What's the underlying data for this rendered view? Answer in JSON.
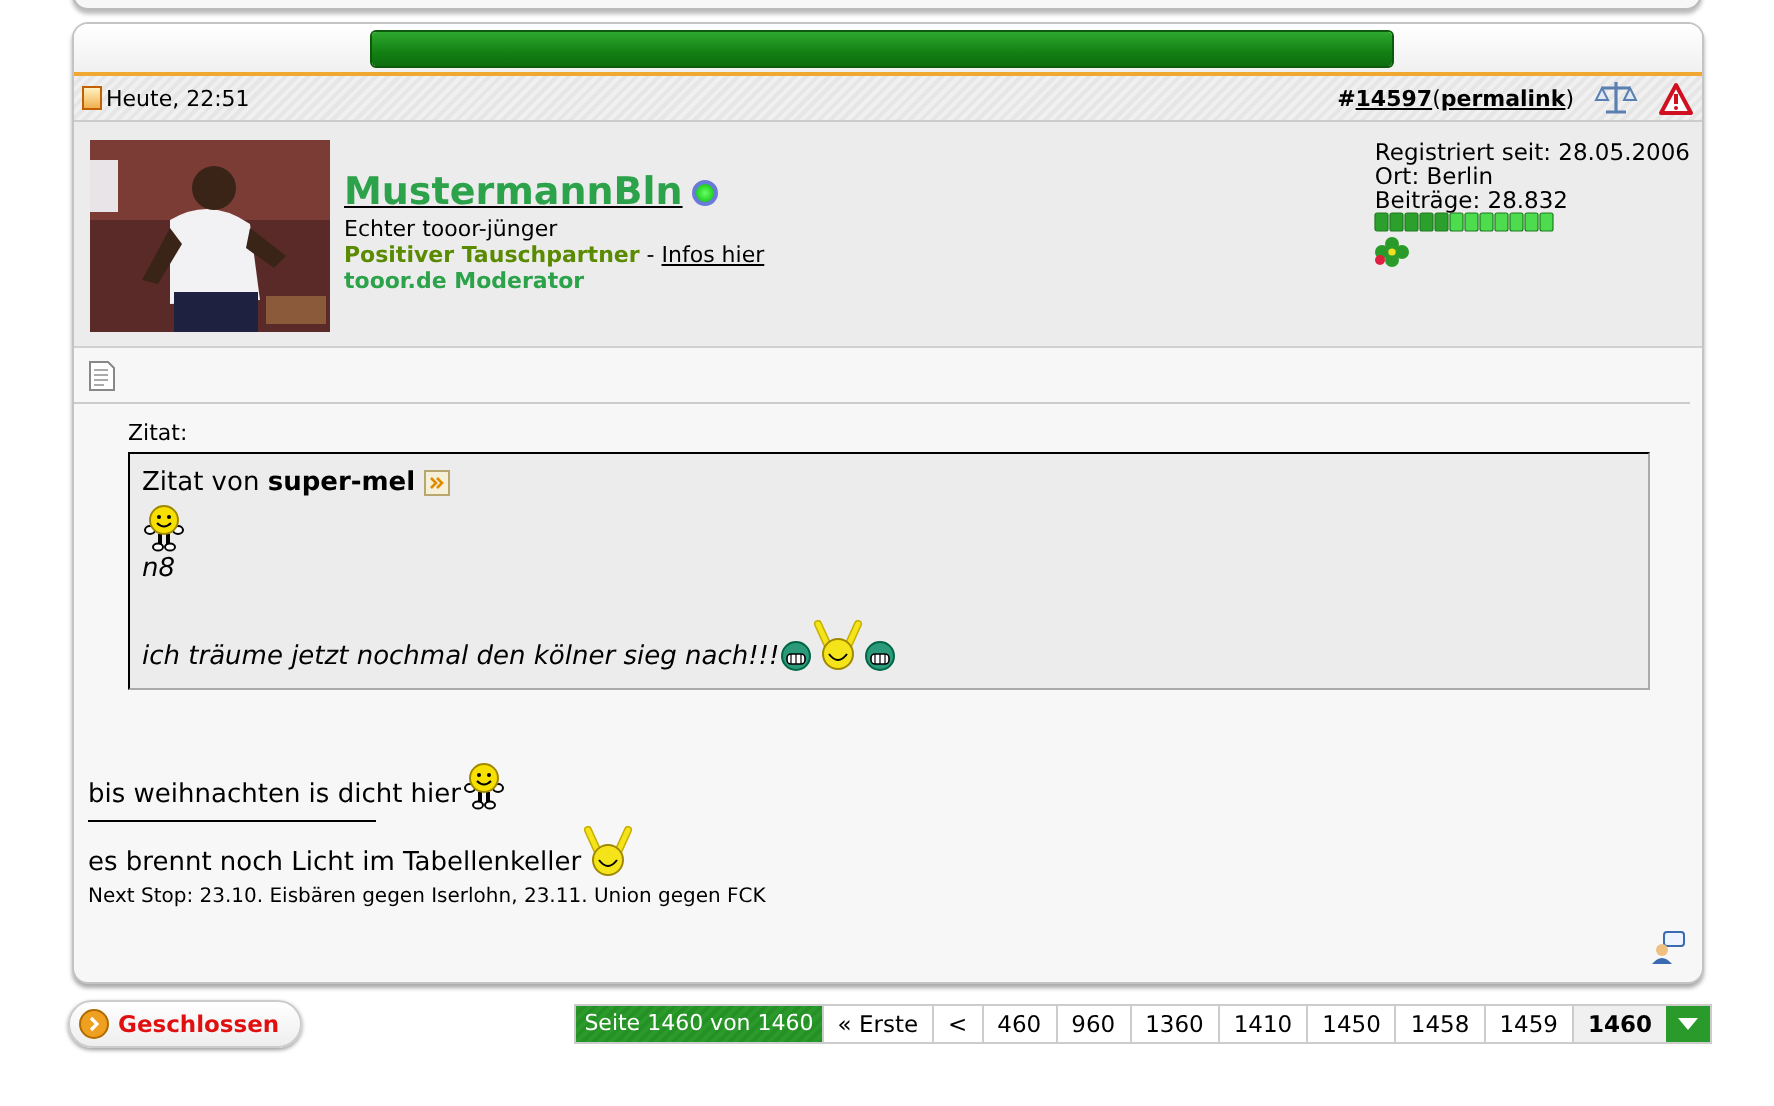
{
  "post": {
    "progress": {
      "level": 1
    },
    "date": "Heute, 22:51",
    "number_prefix": "#",
    "number": "14597",
    "permalink_open": "(",
    "permalink": "permalink",
    "permalink_close": ")",
    "user": {
      "name": "MustermannBln",
      "online": true,
      "title": "Echter tooor-jünger",
      "trade_label": "Positiver Tauschpartner",
      "separator": "-",
      "trade_link": "Infos hier",
      "role": "tooor.de Moderator"
    },
    "user_info": [
      "Registriert seit: 28.05.2006",
      "Ort: Berlin",
      "Beiträge: 28.832"
    ],
    "quote": {
      "label": "Zitat:",
      "heading": "Zitat von **super-mel**",
      "lines": [
        {
          "emoticons": [
            {
              "kind": "walking"
            }
          ]
        },
        {
          "text": "n8"
        },
        {
          "text": "ich träume jetzt nochmal den kölner sieg nach!!!",
          "emoticons": [
            {
              "kind": "grin"
            },
            {
              "kind": "cheer"
            },
            {
              "kind": "grin"
            }
          ]
        }
      ]
    },
    "message": [
      {
        "text": "bis weihnachten is dicht hier",
        "emoticons": [
          {
            "kind": "walking"
          }
        ]
      }
    ],
    "signature": [
      {
        "text": "es brennt noch Licht im Tabellenkeller",
        "emoticons": [
          {
            "kind": "cheer"
          }
        ],
        "kind": "normal"
      },
      {
        "text": "Next Stop: 23.10. Eisbären gegen Iserlohn, 23.11. Union gegen FCK",
        "kind": "small"
      }
    ]
  },
  "thread_status": "Geschlossen",
  "pagination": {
    "label": "Seite 1460 von 1460",
    "pages": [
      {
        "text": "« Erste",
        "selected": false
      },
      {
        "text": "<",
        "selected": false
      },
      {
        "text": "460",
        "selected": false
      },
      {
        "text": "960",
        "selected": false
      },
      {
        "text": "1360",
        "selected": false
      },
      {
        "text": "1410",
        "selected": false
      },
      {
        "text": "1450",
        "selected": false
      },
      {
        "text": "1458",
        "selected": false
      },
      {
        "text": "1459",
        "selected": false
      },
      {
        "text": "1460",
        "selected": true
      }
    ]
  }
}
